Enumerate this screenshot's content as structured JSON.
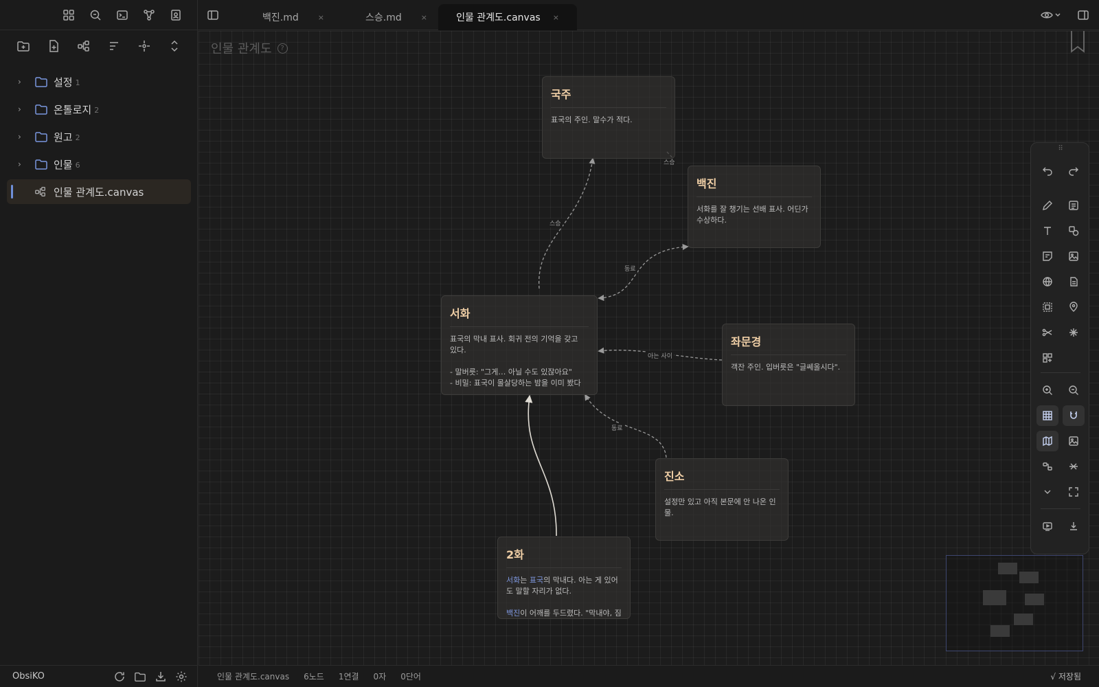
{
  "tabs": [
    {
      "label": "백진.md",
      "close": "×"
    },
    {
      "label": "스승.md",
      "close": "×"
    },
    {
      "label": "인물 관계도.canvas",
      "close": "×"
    }
  ],
  "sidebar": {
    "items": [
      {
        "label": "설정",
        "count": "1"
      },
      {
        "label": "온톨로지",
        "count": "2"
      },
      {
        "label": "원고",
        "count": "2"
      },
      {
        "label": "인물",
        "count": "6"
      }
    ],
    "active_file": "인물 관계도.canvas",
    "vault_name": "ObsiKO"
  },
  "canvas": {
    "title": "인물 관계도",
    "help": "?",
    "nodes": {
      "gukju": {
        "title": "국주",
        "text": "표국의 주인. 말수가 적다."
      },
      "baekjin": {
        "title": "백진",
        "text": "서화를 잘 챙기는 선배 표사. 어딘가\n수상하다."
      },
      "seohwa": {
        "title": "서화",
        "text": "표국의 막내 표사. 회귀 전의 기억을 갖고\n있다.\n\n- 말버릇: \"그게… 아닐 수도 있잖아요\"\n- 비밀: 표국이 몰살당하는 밤을 이미 봤다"
      },
      "jwamungyeong": {
        "title": "좌문경",
        "text": "객잔 주인. 입버릇은 \"글쎄올시다\"."
      },
      "jinso": {
        "title": "진소",
        "text": "설정만 있고 아직 본문에 안 나온 인\n물."
      },
      "ep2": {
        "title": "2화",
        "line1_link1": "서화",
        "line1_mid": "는 ",
        "line1_link2": "표국",
        "line1_rest": "의 막내다. 아는 게 있어\n도 말할 자리가 없다.",
        "line2_link": "백진",
        "line2_rest": "이 어깨를 두드렸다. \"막내야, 짐"
      }
    },
    "edges": {
      "gukju_baekjin": "스승",
      "seohwa_gukju": "스승",
      "seohwa_baekjin": "동료",
      "jwamun_seohwa": "아는 사이",
      "jinso_seohwa": "동료"
    }
  },
  "toolbar": {
    "grip": "⠿"
  },
  "status": {
    "file": "인물 관계도.canvas",
    "nodes": "6노드",
    "links": "1연결",
    "chars": "0자",
    "words": "0단어",
    "saved": "√ 저장됨"
  }
}
